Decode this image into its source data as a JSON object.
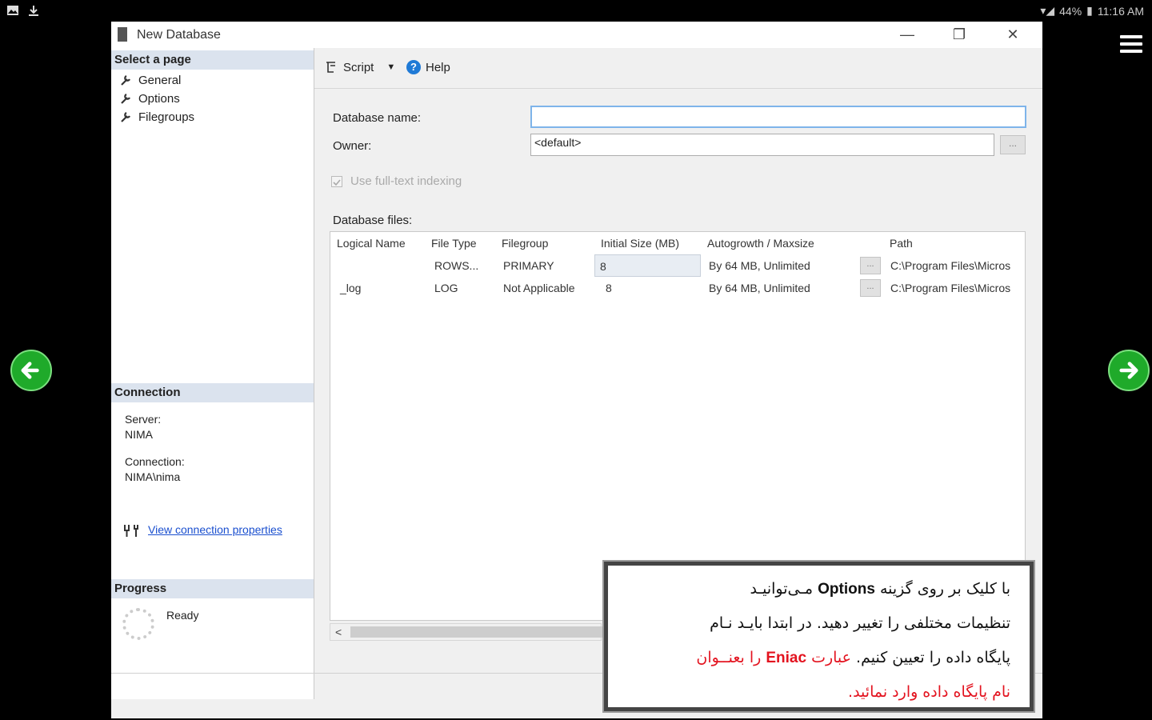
{
  "status_bar": {
    "battery": "44%",
    "time": "11:16 AM"
  },
  "window": {
    "title": "New Database",
    "minimize_glyph": "—",
    "restore_glyph": "❐",
    "close_glyph": "✕"
  },
  "left_panel": {
    "select_page_header": "Select a page",
    "pages": [
      "General",
      "Options",
      "Filegroups"
    ],
    "connection_header": "Connection",
    "server_label": "Server:",
    "server_value": "NIMA",
    "connection_label": "Connection:",
    "connection_value": "NIMA\\nima",
    "view_connection_link": "View connection properties",
    "progress_header": "Progress",
    "progress_status": "Ready"
  },
  "toolbar": {
    "script_label": "Script",
    "help_label": "Help"
  },
  "form": {
    "database_name_label": "Database name:",
    "database_name_value": "",
    "owner_label": "Owner:",
    "owner_value": "<default>",
    "browse_label": "...",
    "fulltext_label": "Use full-text indexing",
    "fulltext_checked": true,
    "database_files_label": "Database files:"
  },
  "grid": {
    "columns": [
      "Logical Name",
      "File Type",
      "Filegroup",
      "Initial Size (MB)",
      "Autogrowth / Maxsize",
      "Path"
    ],
    "rows": [
      {
        "logical_name": "",
        "file_type": "ROWS...",
        "filegroup": "PRIMARY",
        "initial_size": "8",
        "autogrowth": "By 64 MB, Unlimited",
        "path": "C:\\Program Files\\Micros"
      },
      {
        "logical_name": "_log",
        "file_type": "LOG",
        "filegroup": "Not Applicable",
        "initial_size": "8",
        "autogrowth": "By 64 MB, Unlimited",
        "path": "C:\\Program Files\\Micros"
      }
    ],
    "scroll_left_arrow": "<"
  },
  "annotation": {
    "line1_a": "با کلیک بر روی گزینه",
    "line1_keyword": "Options",
    "line1_b": "مـی‌توانیـد",
    "line2": "تنظیمات مختلفی را تغییر دهید. در ابتدا بایـد نـام",
    "line3_a": "پایگاه داده را تعیین کنیم.",
    "line3_red": "عبارت",
    "line3_keyword": "Eniac",
    "line3_red_b": "را بعنــوان",
    "line4": "نام پایگاه داده وارد نمائید."
  },
  "colors": {
    "accent_link": "#1a4fcf",
    "nav_green": "#1faa2a",
    "annotation_red": "#e3131f"
  }
}
